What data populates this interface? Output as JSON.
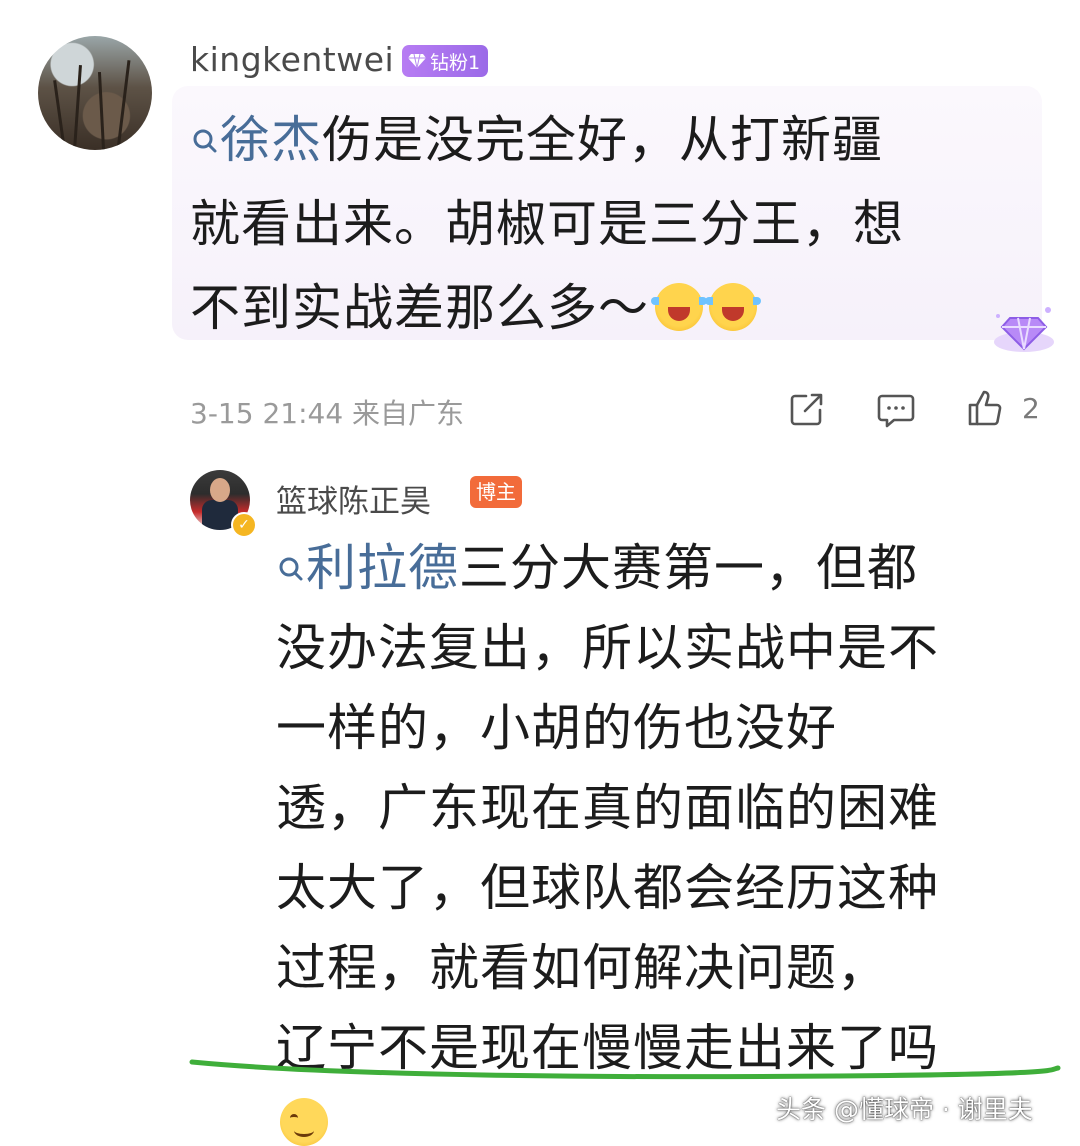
{
  "comment": {
    "username": "kingkentwei",
    "badge": "钻粉1",
    "mention": "徐杰",
    "text_line1": "伤是没完全好，从打新疆",
    "text_line2": "就看出来。胡椒可是三分王，想",
    "text_line3": "不到实战差那么多～",
    "emojis": [
      "laughing-crying-emoji",
      "laughing-crying-emoji"
    ],
    "timestamp": "3-15 21:44",
    "location": "来自广东",
    "like_count": "2",
    "icons": [
      "share-icon",
      "comment-icon",
      "thumbs-up-icon"
    ]
  },
  "reply": {
    "username": "篮球陈正昊",
    "badge": "博主",
    "verified_icon": "verified-check-icon",
    "mention": "利拉德",
    "lines": [
      "三分大赛第一，但都",
      "没办法复出，所以实战中是不",
      "一样的，小胡的伤也没好",
      "透，广东现在真的面临的困难",
      "太大了，但球队都会经历这种",
      "过程，就看如何解决问题，",
      "辽宁不是现在慢慢走出来了吗"
    ],
    "trailing_emoji": "smile-emoji"
  },
  "watermark": "头条 @懂球帝 · 谢里夫",
  "colors": {
    "mention": "#486d98",
    "badge_purple": "#a872ee",
    "badge_orange": "#f26b3a",
    "underline_green": "#3fae3a"
  }
}
